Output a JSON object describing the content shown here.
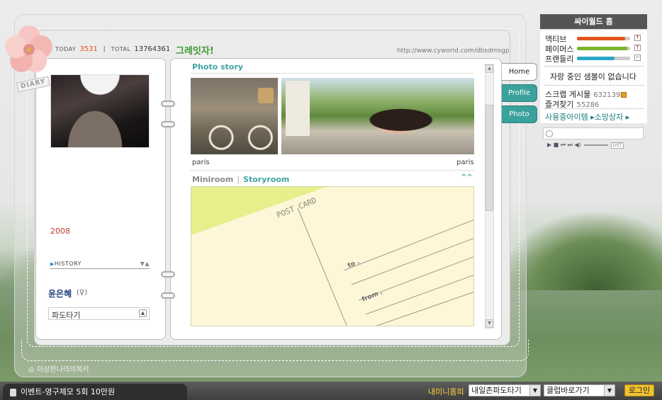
{
  "counters": {
    "today_label": "TODAY",
    "today_value": "3531",
    "total_label": "TOTAL",
    "total_value": "13764361"
  },
  "headline": "그레잇자!",
  "home_url": "http://www.cyworld.com/dbsdmsgp",
  "left": {
    "diary_badge": "DIARY",
    "year": "2008",
    "history_label": "HISTORY",
    "owner_name": "윤은혜",
    "owner_sex": "(♀)",
    "mood_value": "파도타기"
  },
  "right": {
    "photo_story_title": "Photo story",
    "photo_caption_1": "paris",
    "photo_caption_2": "paris",
    "miniroom_label": "Miniroom",
    "storyroom_label": "Storyroom",
    "caret": "^^",
    "postcard_title": "POST CARD",
    "postcard_to": "to .",
    "postcard_from": "from ."
  },
  "tabs": {
    "home": "Home",
    "profile": "Profile",
    "photo": "Photo"
  },
  "side": {
    "world_home": "싸이월드 홈",
    "stats": [
      {
        "label": "액티브",
        "level": 0.9,
        "color": "#e2541f"
      },
      {
        "label": "페이머스",
        "level": 0.95,
        "color": "#7ab52d"
      },
      {
        "label": "프랜들리",
        "level": 0.7,
        "color": "#2aa6c8"
      }
    ],
    "no_sample_text": "자랑 중인 샘볼이 없습니다",
    "scrap_label": "스크랩 게시물",
    "scrap_count": "632139",
    "fav_label": "즐겨찾기",
    "fav_count": "55286",
    "items_text": "사용중아이템 ▸소망상자 ▸",
    "player_list": "LIST"
  },
  "footer_sign": "◎ 이상한나라의복키",
  "bottom": {
    "event_text": "이벤트-영구제모 5회 10만원",
    "my_minihompy": "내미니홈피",
    "select_1": "내일촌파도타기",
    "select_2": "클럽바로가기",
    "login": "로그인"
  }
}
